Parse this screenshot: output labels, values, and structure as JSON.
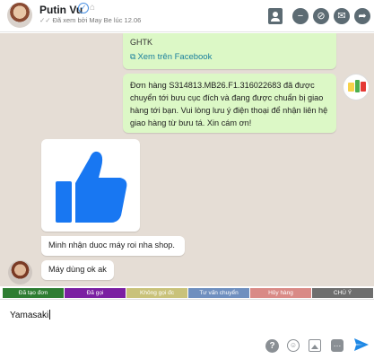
{
  "header": {
    "name": "Putin Vu",
    "seen_text": "Đã xem bởi May Be lúc 12.06"
  },
  "messages": {
    "ghtk_card_text": "GHTK",
    "ghtk_link": "Xem trên Facebook",
    "shop_message": "Đơn hàng S314813.MB26.F1.316022683 đã được chuyển tới bưu cục đích và đang được chuẩn bị giao hàng tới bạn. Vui lòng lưu ý điện thoại để nhận liên hệ giao hàng từ bưu tá. Xin cám ơn!",
    "customer_message_1": "Minh nhận duoc máy roi nha shop.",
    "customer_message_2": "Máy dùng ok ak"
  },
  "tags": [
    {
      "label": "Đã tạo đơn",
      "color": "#2e7d32"
    },
    {
      "label": "Đã gọi",
      "color": "#7b1fa2"
    },
    {
      "label": "Không gọi đc",
      "color": "#c9c27a"
    },
    {
      "label": "Tư vấn chuyển",
      "color": "#6f8fbf"
    },
    {
      "label": "Hủy hàng",
      "color": "#d98a86"
    },
    {
      "label": "CHÚ Ý",
      "color": "#6e6e6e"
    }
  ],
  "composer": {
    "value": "Yamasaki"
  },
  "colors": {
    "outgoing_bubble": "#dcf8c6",
    "incoming_bubble": "#ffffff",
    "chat_background": "#e5ddd5",
    "link": "#1a7f9c",
    "thumb": "#1877f2",
    "send": "#1e88e5"
  },
  "icons": [
    "verified-icon",
    "profile-icon",
    "contact-card-icon",
    "minus-circle-icon",
    "block-icon",
    "mail-icon",
    "share-icon",
    "external-link-icon",
    "thumbs-up-icon",
    "help-icon",
    "emoji-icon",
    "image-icon",
    "more-icon",
    "send-icon"
  ]
}
